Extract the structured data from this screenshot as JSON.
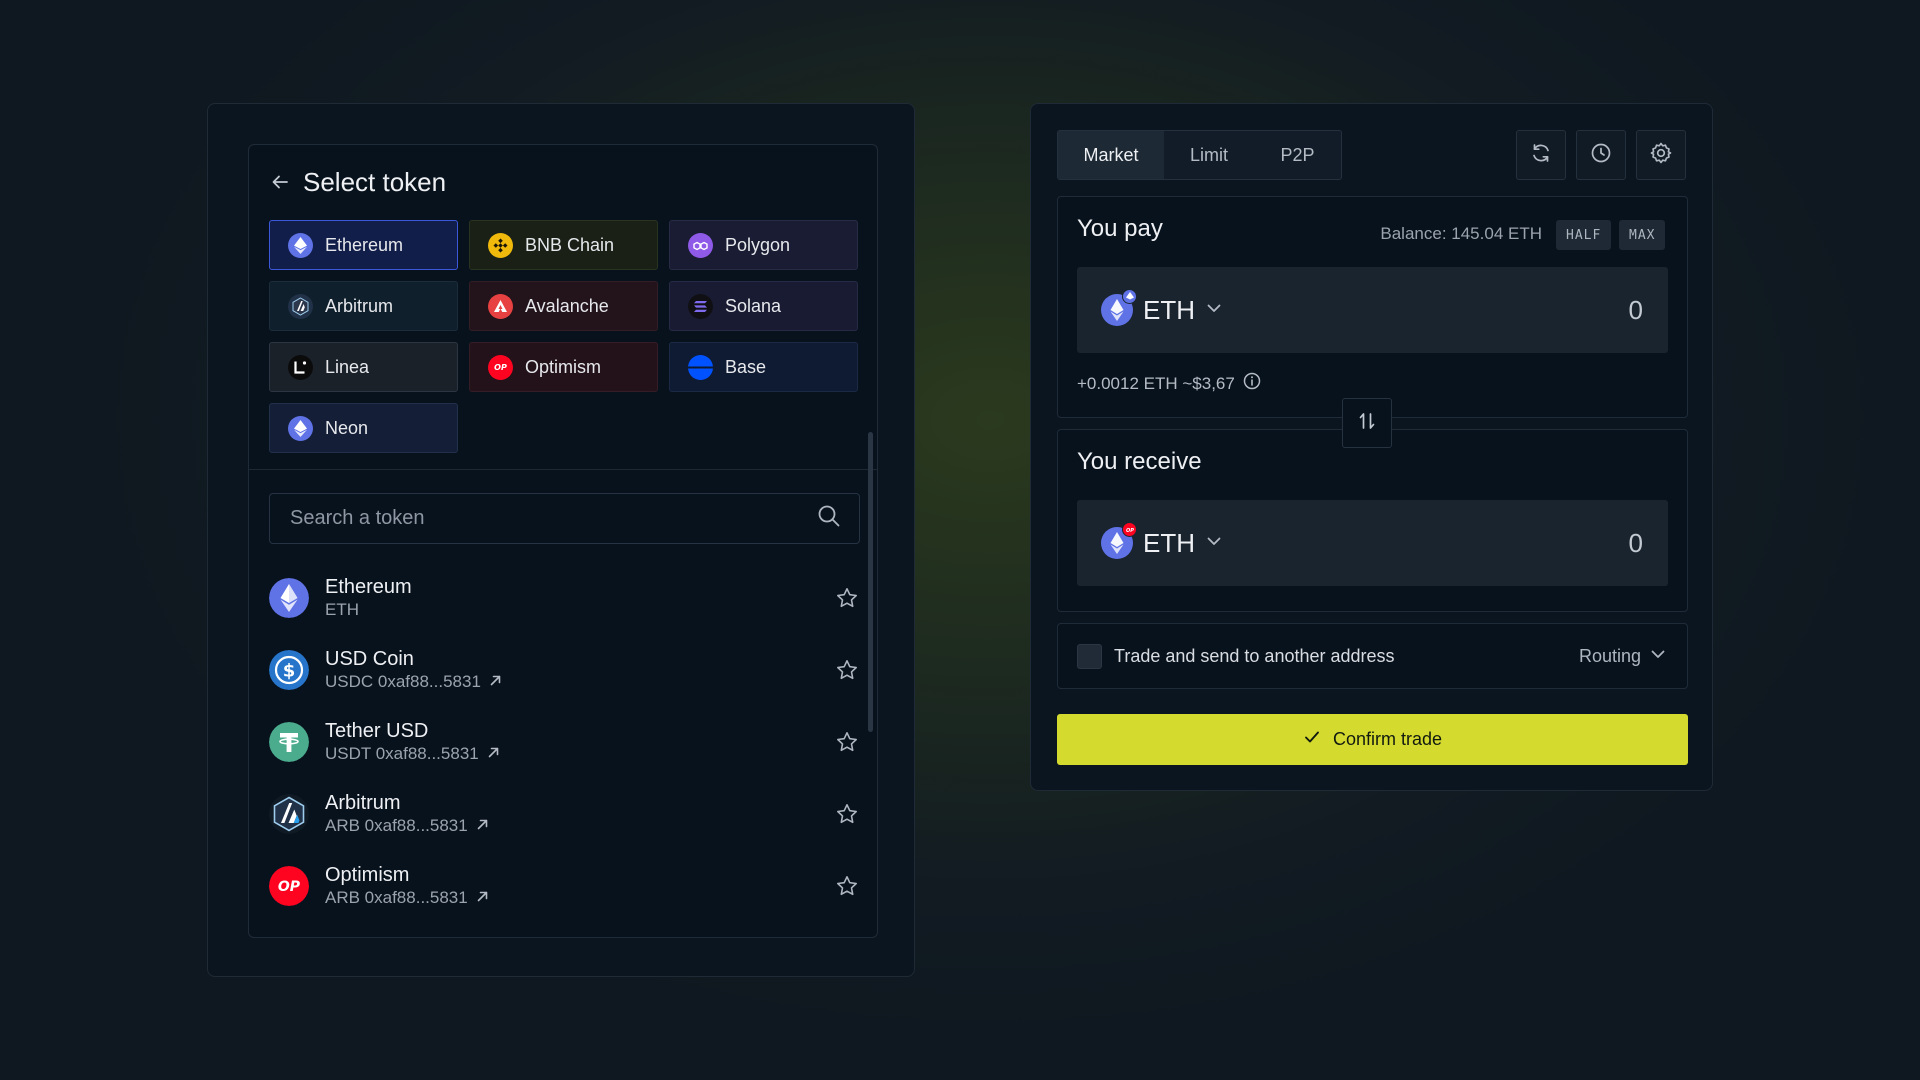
{
  "select_token": {
    "title": "Select token",
    "chains": [
      {
        "label": "Ethereum",
        "icon": "ethereum-icon",
        "bg": "#121e4a",
        "border": "#3c58d8",
        "iconbg": "#5f72e6"
      },
      {
        "label": "BNB Chain",
        "icon": "bnb-icon",
        "bg": "#1a2016",
        "border": "#2a3220",
        "iconbg": "#f0b90b"
      },
      {
        "label": "Polygon",
        "icon": "polygon-icon",
        "bg": "#191c33",
        "border": "#272b45",
        "iconbg": "#8f5ae8"
      },
      {
        "label": "Arbitrum",
        "icon": "arbitrum-icon",
        "bg": "#0f1f2c",
        "border": "#1b2c3b",
        "iconbg": "#213147"
      },
      {
        "label": "Avalanche",
        "icon": "avalanche-icon",
        "bg": "#22141a",
        "border": "#331e25",
        "iconbg": "#e84142"
      },
      {
        "label": "Solana",
        "icon": "solana-icon",
        "bg": "#191b33",
        "border": "#262a45",
        "iconbg": "#101014"
      },
      {
        "label": "Linea",
        "icon": "linea-icon",
        "bg": "#1a2129",
        "border": "#2c3642",
        "iconbg": "#0b0b0b"
      },
      {
        "label": "Optimism",
        "icon": "optimism-icon",
        "bg": "#24121a",
        "border": "#351c25",
        "iconbg": "#ff0420"
      },
      {
        "label": "Base",
        "icon": "base-icon",
        "bg": "#0f1b33",
        "border": "#1b2945",
        "iconbg": "#0052ff"
      },
      {
        "label": "Neon",
        "icon": "neon-icon",
        "bg": "#141f37",
        "border": "#22304a",
        "iconbg": "#5f72e6"
      }
    ],
    "search_placeholder": "Search a token",
    "tokens": [
      {
        "name": "Ethereum",
        "sub": "ETH",
        "logo": "ethereum-logo",
        "color": "#5f72e6",
        "has_link": false
      },
      {
        "name": "USD Coin",
        "sub": "USDC 0xaf88...5831",
        "logo": "usdc-logo",
        "color": "#2775ca",
        "has_link": true
      },
      {
        "name": "Tether USD",
        "sub": "USDT 0xaf88...5831",
        "logo": "tether-logo",
        "color": "#4bac8d",
        "has_link": true
      },
      {
        "name": "Arbitrum",
        "sub": "ARB 0xaf88...5831",
        "logo": "arbitrum-logo",
        "color": "#213147",
        "has_link": true
      },
      {
        "name": "Optimism",
        "sub": "ARB 0xaf88...5831",
        "logo": "optimism-logo",
        "color": "#ff0420",
        "has_link": true
      }
    ]
  },
  "trade": {
    "tabs": [
      {
        "label": "Market",
        "active": true
      },
      {
        "label": "Limit",
        "active": false
      },
      {
        "label": "P2P",
        "active": false
      }
    ],
    "tools": [
      "refresh-icon",
      "history-icon",
      "settings-icon"
    ],
    "pay": {
      "title": "You pay",
      "balance": "Balance: 145.04 ETH",
      "half_label": "HALF",
      "max_label": "MAX",
      "token": "ETH",
      "amount": "0",
      "fee": "+0.0012 ETH ~$3,67"
    },
    "receive": {
      "title": "You receive",
      "token": "ETH",
      "amount": "0"
    },
    "send_label": "Trade and send to another address",
    "routing_label": "Routing",
    "confirm_label": "Confirm trade"
  },
  "colors": {
    "accent": "#d5db2e",
    "panel": "#0b1520",
    "card": "#08121d",
    "field": "#1a242f"
  }
}
